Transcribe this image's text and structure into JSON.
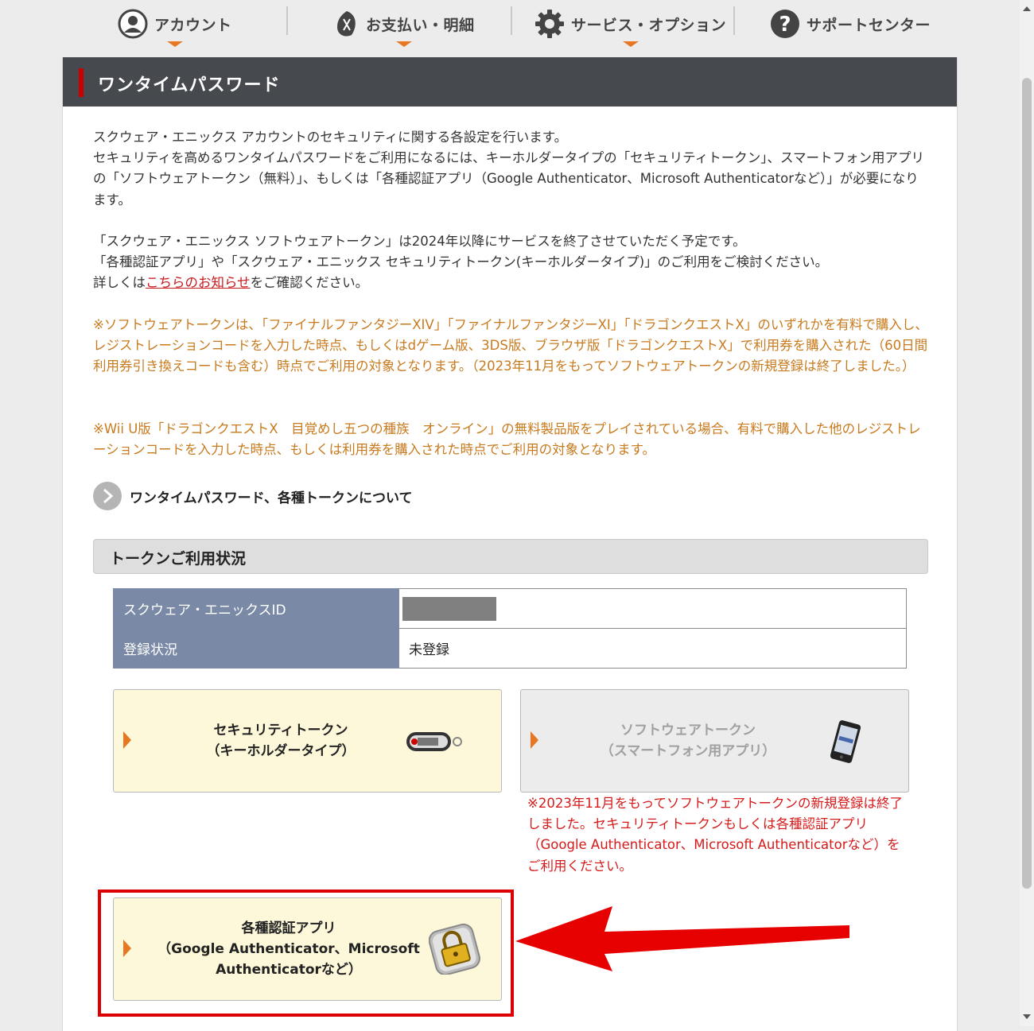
{
  "nav": {
    "account": "アカウント",
    "payment": "お支払い・明細",
    "service": "サービス・オプション",
    "support": "サポートセンター"
  },
  "header": {
    "title": "ワンタイムパスワード"
  },
  "intro": {
    "line1": "スクウェア・エニックス アカウントのセキュリティに関する各設定を行います。",
    "line2": "セキュリティを高めるワンタイムパスワードをご利用になるには、キーホルダータイプの「セキュリティトークン」、スマートフォン用アプリの「ソフトウェアトークン（無料）」、もしくは「各種認証アプリ（Google Authenticator、Microsoft Authenticatorなど）」が必要になります。"
  },
  "notice": {
    "line1": "「スクウェア・エニックス ソフトウェアトークン」は2024年以降にサービスを終了させていただく予定です。",
    "line2": "「各種認証アプリ」や「スクウェア・エニックス セキュリティトークン(キーホルダータイプ)」のご利用をご検討ください。",
    "line3_pre": "詳しくは",
    "line3_link": "こちらのお知らせ",
    "line3_post": "をご確認ください。"
  },
  "orange_notes": {
    "note1": "※ソフトウェアトークンは、「ファイナルファンタジーXIV」「ファイナルファンタジーXI」「ドラゴンクエストX」のいずれかを有料で購入し、レジストレーションコードを入力した時点、もしくはdゲーム版、3DS版、ブラウザ版「ドラゴンクエストX」で利用券を購入された（60日間利用券引き換えコードも含む）時点でご利用の対象となります。（2023年11月をもってソフトウェアトークンの新規登録は終了しました。）",
    "note2": "※Wii U版「ドラゴンクエストX　目覚めし五つの種族　オンライン」の無料製品版をプレイされている場合、有料で購入した他のレジストレーションコードを入力した時点、もしくは利用券を購入された時点でご利用の対象となります。"
  },
  "info_link": "ワンタイムパスワード、各種トークンについて",
  "token_section": {
    "title": "トークンご利用状況",
    "rows": [
      {
        "label": "スクウェア・エニックスID",
        "value": ""
      },
      {
        "label": "登録状況",
        "value": "未登録"
      }
    ]
  },
  "cards": {
    "security_token": {
      "line1": "セキュリティトークン",
      "line2": "（キーホルダータイプ）"
    },
    "software_token": {
      "line1": "ソフトウェアトークン",
      "line2": "（スマートフォン用アプリ）"
    },
    "auth_app": {
      "line1": "各種認証アプリ",
      "line2": "（Google Authenticator、Microsoft",
      "line3": "Authenticatorなど）"
    }
  },
  "software_note": "※2023年11月をもってソフトウェアトークンの新規登録は終了しました。セキュリティトークンもしくは各種認証アプリ（Google Authenticator、Microsoft Authenticatorなど）をご利用ください。",
  "colors": {
    "accent": "#e87722",
    "header_bg": "#46494d",
    "table_header": "#7a8aa6",
    "card_bg": "#fdf8da",
    "highlight": "#dd0000"
  }
}
